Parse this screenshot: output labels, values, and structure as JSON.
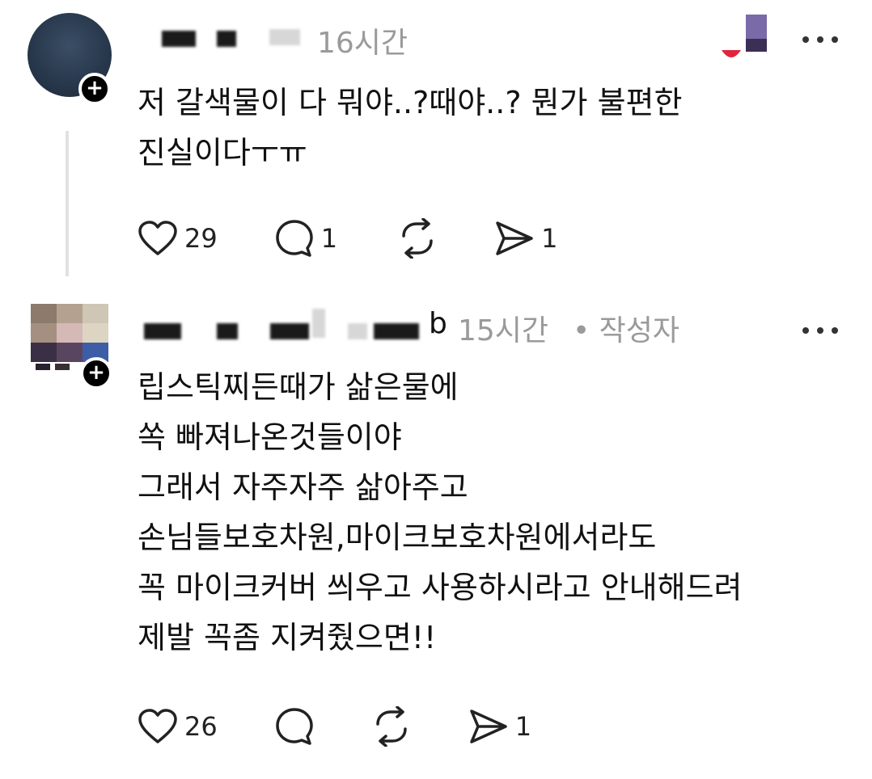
{
  "post1": {
    "time": "16시간",
    "body": "저 갈색물이 다 뭐야..?때야..? 뭔가 불편한\n진실이다ㅜㅠ",
    "likes": "29",
    "comments": "1",
    "reposts": "",
    "shares": "1",
    "more_icon": "ellipsis-icon"
  },
  "post2": {
    "name_tail": "b",
    "time": "15시간",
    "author_badge": "• 작성자",
    "body": "립스틱찌든때가 삶은물에\n쏙 빠져나온것들이야\n그래서 자주자주 삶아주고\n손님들보호차원,마이크보호차원에서라도\n꼭 마이크커버 씌우고 사용하시라고 안내해드려\n제발 꼭좀 지켜줬으면!!",
    "likes": "26",
    "comments": "",
    "reposts": "",
    "shares": "1",
    "more_icon": "ellipsis-icon"
  },
  "colors": {
    "text": "#111111",
    "meta": "#9a9a9a",
    "line": "#e2e2e2"
  }
}
